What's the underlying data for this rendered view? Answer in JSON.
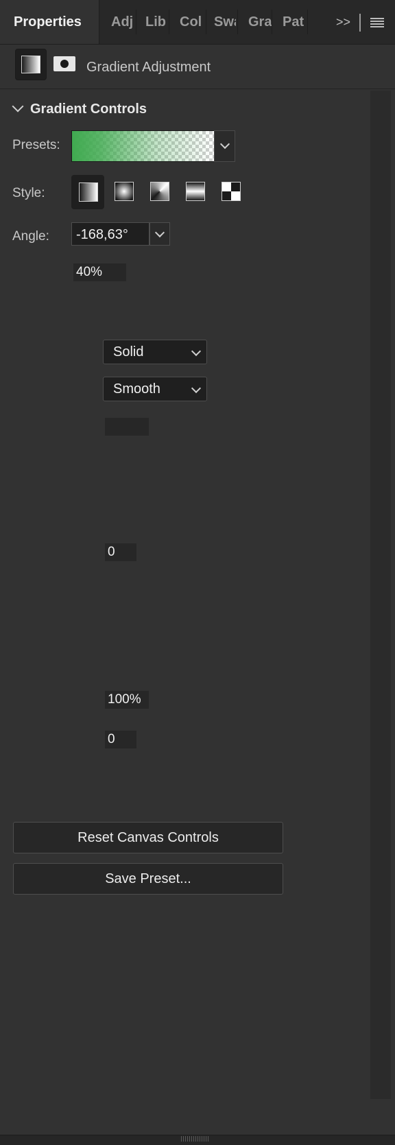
{
  "tabs": [
    {
      "label": "Properties"
    },
    {
      "label": "Adj"
    },
    {
      "label": "Lib"
    },
    {
      "label": "Col"
    },
    {
      "label": "Swa"
    },
    {
      "label": "Gra"
    },
    {
      "label": "Pat"
    }
  ],
  "overflow_label": ">>",
  "header": {
    "title": "Gradient Adjustment"
  },
  "section": {
    "title": "Gradient Controls"
  },
  "presets": {
    "label": "Presets:",
    "colors": [
      "#3fa94f",
      "transparent"
    ]
  },
  "style": {
    "label": "Style:",
    "options": [
      "linear-icon",
      "radial-icon",
      "angle-icon",
      "reflected-icon",
      "diamond-icon"
    ],
    "selected": 0
  },
  "angle": {
    "label": "Angle:",
    "value": "-168,63°"
  },
  "fields": {
    "scale": "40%",
    "method_select": "Solid",
    "smooth_select": "Smooth",
    "blank": "",
    "value_a": "0",
    "opacity": "100%",
    "value_b": "0"
  },
  "buttons": {
    "reset": "Reset Canvas Controls",
    "save": "Save Preset..."
  }
}
